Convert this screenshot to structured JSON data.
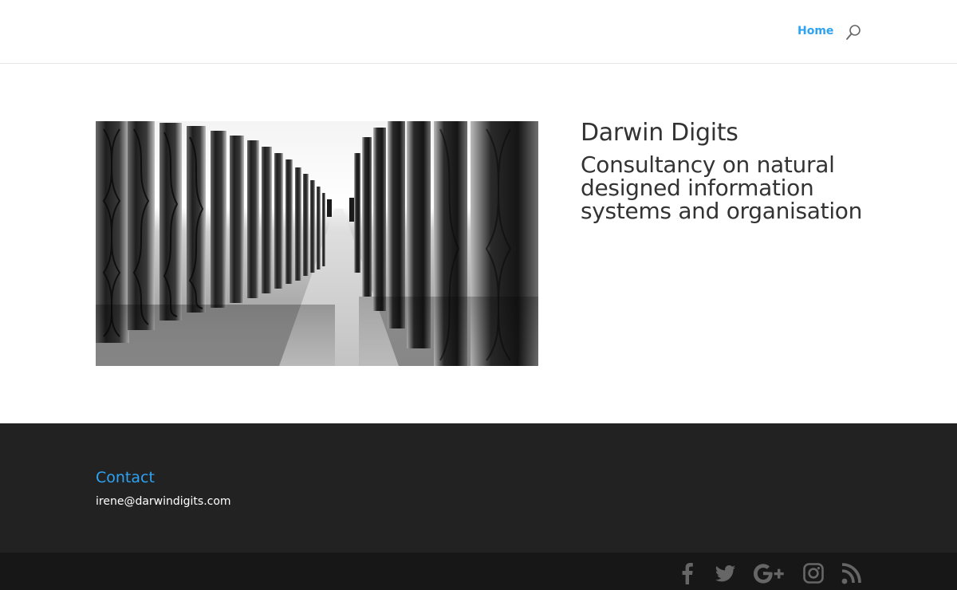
{
  "nav": {
    "home_label": "Home"
  },
  "hero": {
    "image_icon": "dna-tubes-image",
    "title": "Darwin Digits",
    "tagline": "Consultancy on natural designed information systems and organisation"
  },
  "footer": {
    "contact_heading": "Contact",
    "email": "irene@darwindigits.com"
  },
  "social": [
    "facebook-icon",
    "twitter-icon",
    "google-plus-icon",
    "instagram-icon",
    "rss-icon"
  ],
  "colors": {
    "accent": "#2ea3f2",
    "text": "#333333",
    "footer_bg": "#222222",
    "bottom_bar_bg": "#171717",
    "social_icon": "#666666"
  }
}
